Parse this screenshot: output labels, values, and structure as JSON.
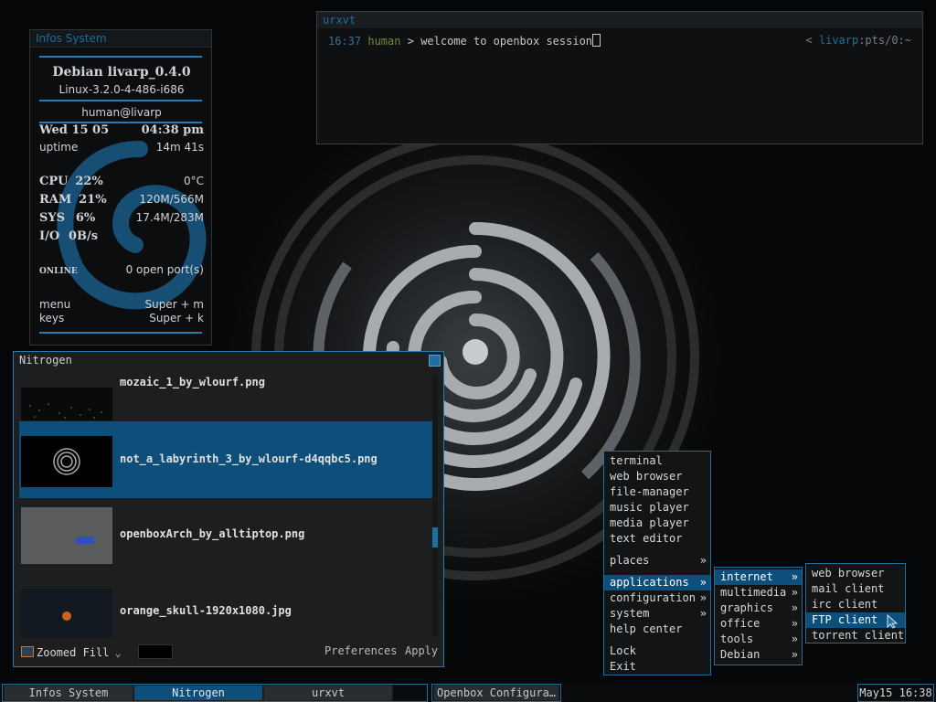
{
  "colors": {
    "accent": "#1f6e9e",
    "selection": "#0d4f7a",
    "background": "#050607"
  },
  "conky": {
    "title": "Infos System",
    "distro": "Debian livarp_0.4.0",
    "kernel": "Linux-3.2.0-4-486-i686",
    "user_host": "human@livarp",
    "date": "Wed 15 05",
    "time": "04:38 pm",
    "uptime_label": "uptime",
    "uptime_value": "14m 41s",
    "cpu_label": "CPU",
    "cpu_value": "22%",
    "cpu_temp": "0°C",
    "ram_label": "RAM",
    "ram_value": "21%",
    "ram_usage": "120M/566M",
    "sys_label": "SYS",
    "sys_value": "6%",
    "sys_usage": "17.4M/283M",
    "io_label": "I/O",
    "io_value": "0B/s",
    "net_label": "online",
    "net_value": "0 open port(s)",
    "menu_label": "menu",
    "menu_keys": "Super + m",
    "keys_label": "keys",
    "keys_keys": "Super + k"
  },
  "terminal": {
    "title": "urxvt",
    "prompt_time": "16:37",
    "prompt_user": "human",
    "prompt_sep": ">",
    "prompt_text": "welcome to openbox session",
    "right_open": "<",
    "right_host": "livarp",
    "right_rest": ":pts/0:~"
  },
  "nitrogen": {
    "title": "Nitrogen",
    "files": [
      "mozaic_1_by_wlourf.png",
      "not_a_labyrinth_3_by_wlourf-d4qqbc5.png",
      "openboxArch_by_alltiptop.png",
      "orange_skull-1920x1080.jpg"
    ],
    "zoom_mode": "Zoomed Fill",
    "preferences_label": "Preferences",
    "apply_label": "Apply"
  },
  "menu_main": {
    "items": [
      "terminal",
      "web browser",
      "file-manager",
      "music player",
      "media player",
      "text editor",
      "places",
      "applications",
      "configuration",
      "system",
      "help center",
      "Lock",
      "Exit"
    ],
    "submenu_arrow": "»"
  },
  "menu_apps": {
    "items": [
      "internet",
      "multimedia",
      "graphics",
      "office",
      "tools",
      "Debian"
    ]
  },
  "menu_internet": {
    "items": [
      "web browser",
      "mail client",
      "irc client",
      "FTP client",
      "torrent client"
    ]
  },
  "taskbar": {
    "tasks": [
      "Infos System",
      "Nitrogen",
      "urxvt"
    ],
    "other_task": "Openbox Configura…",
    "clock": "May15 16:38"
  }
}
